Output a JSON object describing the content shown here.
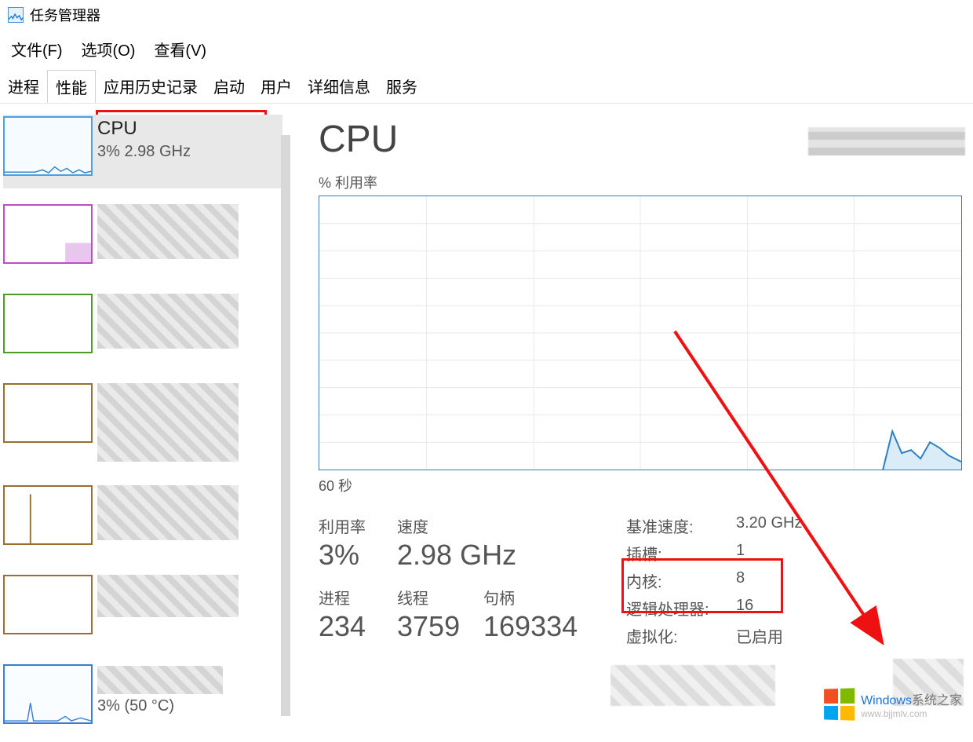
{
  "app_title": "任务管理器",
  "menu": {
    "file": "文件(F)",
    "options": "选项(O)",
    "view": "查看(V)"
  },
  "tabs": [
    "进程",
    "性能",
    "应用历史记录",
    "启动",
    "用户",
    "详细信息",
    "服务"
  ],
  "active_tab": 1,
  "sidebar": {
    "items": [
      {
        "title": "CPU",
        "sub": "3% 2.98 GHz",
        "selected": true,
        "thumb_color": "cpu"
      },
      {
        "title": "",
        "sub": "",
        "thumb_color": "mem",
        "pixelated": true
      },
      {
        "title": "",
        "sub": "",
        "thumb_color": "disk0",
        "pixelated": true
      },
      {
        "title": "",
        "sub": "",
        "thumb_color": "disk1",
        "pixelated": true
      },
      {
        "title": "",
        "sub": "",
        "thumb_color": "disk2",
        "pixelated": true
      },
      {
        "title": "",
        "sub": "",
        "thumb_color": "eth",
        "pixelated": true
      },
      {
        "title": "",
        "sub": "3%  (50 °C)",
        "thumb_color": "gpu",
        "pixelated": true
      }
    ]
  },
  "main": {
    "title": "CPU",
    "chart_y_label": "% 利用率",
    "chart_x_label": "60 秒",
    "stats_left": {
      "util_label": "利用率",
      "util_value": "3%",
      "speed_label": "速度",
      "speed_value": "2.98 GHz",
      "proc_label": "进程",
      "proc_value": "234",
      "thread_label": "线程",
      "thread_value": "3759",
      "handle_label": "句柄",
      "handle_value": "169334"
    },
    "stats_right": {
      "base_speed_label": "基准速度:",
      "base_speed_value": "3.20 GHz",
      "sockets_label": "插槽:",
      "sockets_value": "1",
      "cores_label": "内核:",
      "cores_value": "8",
      "logical_label": "逻辑处理器:",
      "logical_value": "16",
      "virt_label": "虚拟化:",
      "virt_value": "已启用"
    }
  },
  "chart_data": {
    "type": "line",
    "title": "CPU % 利用率",
    "xlabel": "60 秒",
    "ylabel": "% 利用率",
    "ylim": [
      0,
      100
    ],
    "x_range_seconds": 60,
    "series": [
      {
        "name": "CPU",
        "values": [
          3,
          3,
          3,
          3,
          3,
          3,
          3,
          3,
          3,
          3,
          3,
          3,
          3,
          3,
          3,
          3,
          3,
          3,
          3,
          3,
          3,
          3,
          3,
          3,
          3,
          3,
          3,
          3,
          3,
          3,
          3,
          3,
          3,
          3,
          3,
          3,
          3,
          3,
          3,
          3,
          3,
          3,
          3,
          3,
          3,
          3,
          3,
          3,
          3,
          3,
          3,
          3,
          4,
          14,
          6,
          7,
          4,
          10,
          8,
          5
        ]
      }
    ]
  },
  "watermark": {
    "brand_blue": "Windows",
    "brand_gray": "系统之家",
    "url": "www.bjjmlv.com"
  }
}
